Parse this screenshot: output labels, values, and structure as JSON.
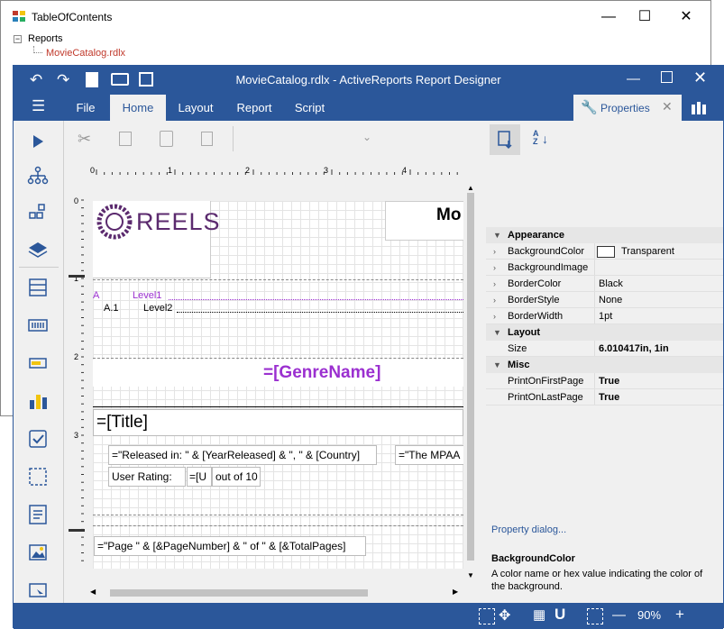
{
  "toc_window": {
    "title": "TableOfContents",
    "tree_root": "Reports",
    "tree_child": "MovieCatalog.rdlx"
  },
  "designer": {
    "title": "MovieCatalog.rdlx - ActiveReports Report Designer",
    "tabs": [
      "File",
      "Home",
      "Layout",
      "Report",
      "Script"
    ],
    "properties_tab": "Properties",
    "accent": "#2b579a"
  },
  "report": {
    "logo_text": "REELS",
    "header_text": "Mo",
    "toc_level1_letter": "A",
    "toc_level1": "Level1",
    "toc_level2_num": "A.1",
    "toc_level2": "Level2",
    "genre": "=[GenreName]",
    "title": "=[Title]",
    "released": "=\"Released in: \" & [YearReleased] & \", \" & [Country]",
    "mpaa": "=\"The MPAA",
    "user_rating_label": "User Rating:",
    "user_rating_expr": "=[U",
    "out_of": "out of 10",
    "page_footer": "=\"Page \" & [&PageNumber] & \" of \" & [&TotalPages]",
    "ruler_h": [
      "0",
      "1",
      "2",
      "3",
      "4"
    ],
    "ruler_v": [
      "0",
      "1",
      "2",
      "3"
    ]
  },
  "properties": {
    "categories": [
      {
        "name": "Appearance",
        "rows": [
          {
            "name": "BackgroundColor",
            "value": "Transparent",
            "swatch": true
          },
          {
            "name": "BackgroundImage",
            "value": ""
          },
          {
            "name": "BorderColor",
            "value": "Black"
          },
          {
            "name": "BorderStyle",
            "value": "None"
          },
          {
            "name": "BorderWidth",
            "value": "1pt"
          }
        ]
      },
      {
        "name": "Layout",
        "rows": [
          {
            "name": "Size",
            "value": "6.010417in, 1in",
            "bold": true
          }
        ]
      },
      {
        "name": "Misc",
        "rows": [
          {
            "name": "PrintOnFirstPage",
            "value": "True",
            "bold": true
          },
          {
            "name": "PrintOnLastPage",
            "value": "True",
            "bold": true
          }
        ]
      }
    ],
    "dialog_link": "Property dialog...",
    "help_title": "BackgroundColor",
    "help_text": "A color name or hex value indicating the color of the background."
  },
  "status": {
    "zoom": "90%"
  }
}
